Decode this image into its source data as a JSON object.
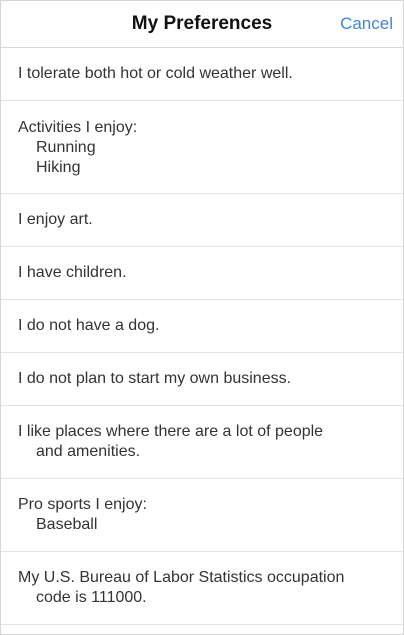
{
  "header": {
    "title": "My Preferences",
    "cancel_label": "Cancel"
  },
  "preferences": [
    {
      "text": "I tolerate both hot or cold weather well."
    },
    {
      "heading": "Activities I enjoy:",
      "items": [
        "Running",
        "Hiking"
      ]
    },
    {
      "text": "I enjoy art."
    },
    {
      "text": "I have children."
    },
    {
      "text": "I do not have a dog."
    },
    {
      "text": "I do not plan to start my own business."
    },
    {
      "line1": "I like places where there are a lot of people",
      "line2": "and amenities."
    },
    {
      "heading": "Pro sports I enjoy:",
      "items": [
        "Baseball"
      ]
    },
    {
      "line1": "My U.S. Bureau of Labor Statistics occupation",
      "line2": "code is 111000."
    }
  ],
  "colors": {
    "accent": "#3f86d9",
    "divider": "#e3e3e3",
    "text": "#333333"
  }
}
